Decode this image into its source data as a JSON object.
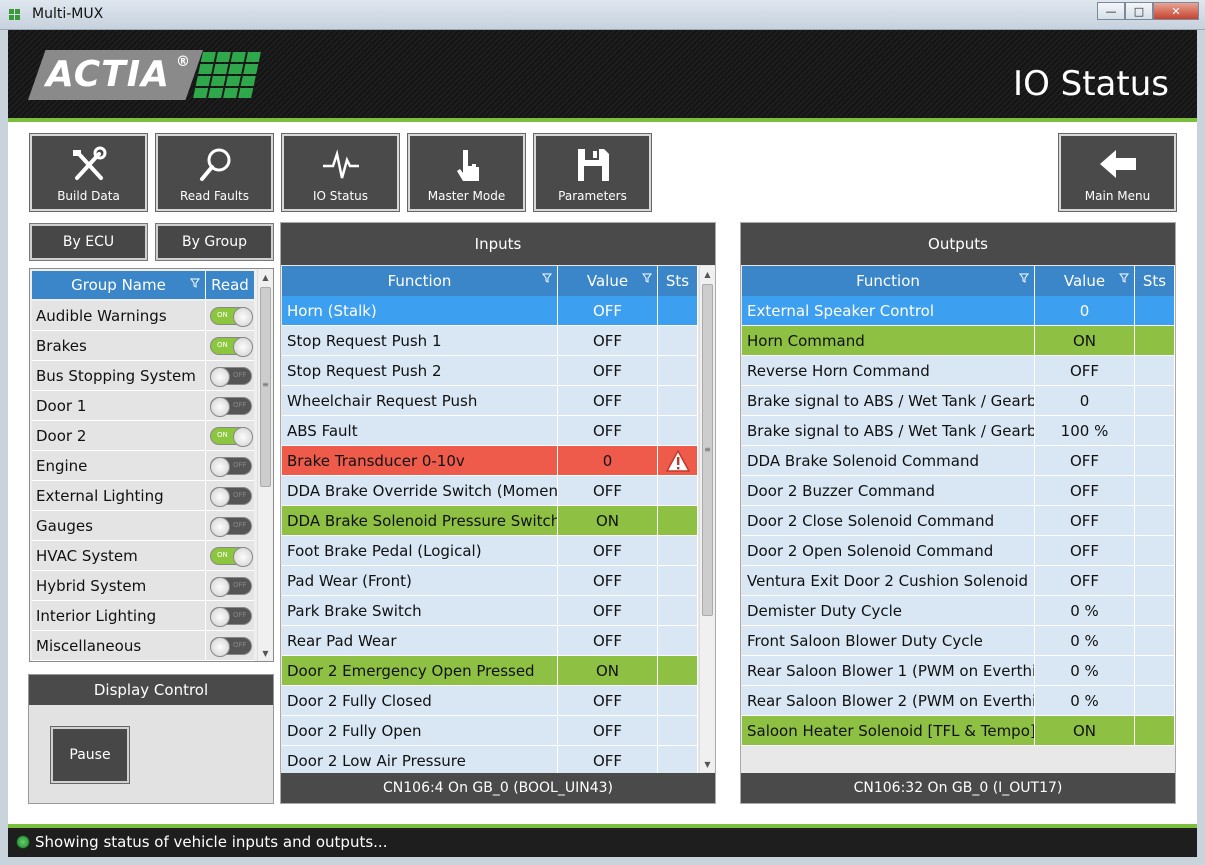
{
  "window": {
    "title": "Multi-MUX"
  },
  "header": {
    "logo_text": "ACTIA",
    "logo_reg": "®",
    "page_title": "IO Status"
  },
  "toolbar": [
    {
      "id": "build-data",
      "label": "Build Data",
      "icon": "tools-icon"
    },
    {
      "id": "read-faults",
      "label": "Read Faults",
      "icon": "magnifier-icon"
    },
    {
      "id": "io-status",
      "label": "IO Status",
      "icon": "pulse-icon"
    },
    {
      "id": "master-mode",
      "label": "Master Mode",
      "icon": "pointer-hand-icon"
    },
    {
      "id": "parameters",
      "label": "Parameters",
      "icon": "floppy-disk-icon"
    }
  ],
  "main_menu": {
    "label": "Main Menu",
    "icon": "arrow-left-icon"
  },
  "tabs": {
    "by_ecu": "By ECU",
    "by_group": "By Group"
  },
  "groups": {
    "col_name": "Group Name",
    "col_read": "Read",
    "rows": [
      {
        "name": "Audible Warnings",
        "read": true
      },
      {
        "name": "Brakes",
        "read": true
      },
      {
        "name": "Bus Stopping System",
        "read": false
      },
      {
        "name": "Door 1",
        "read": false
      },
      {
        "name": "Door 2",
        "read": true
      },
      {
        "name": "Engine",
        "read": false
      },
      {
        "name": "External Lighting",
        "read": false
      },
      {
        "name": "Gauges",
        "read": false
      },
      {
        "name": "HVAC System",
        "read": true
      },
      {
        "name": "Hybrid System",
        "read": false
      },
      {
        "name": "Interior Lighting",
        "read": false
      },
      {
        "name": "Miscellaneous",
        "read": false
      }
    ],
    "toggle_on": "ON",
    "toggle_off": "OFF"
  },
  "display_control": {
    "title": "Display Control",
    "pause_label": "Pause"
  },
  "inputs": {
    "title": "Inputs",
    "columns": [
      "Function",
      "Value",
      "Sts"
    ],
    "footer": "CN106:4 On GB_0 (BOOL_UIN43)",
    "rows": [
      {
        "fn": "Horn (Stalk)",
        "value": "OFF",
        "state": "sel"
      },
      {
        "fn": "Stop Request Push 1",
        "value": "OFF",
        "state": ""
      },
      {
        "fn": "Stop Request Push 2",
        "value": "OFF",
        "state": ""
      },
      {
        "fn": "Wheelchair Request Push",
        "value": "OFF",
        "state": ""
      },
      {
        "fn": "ABS Fault",
        "value": "OFF",
        "state": ""
      },
      {
        "fn": "Brake Transducer 0-10v",
        "value": "0",
        "state": "err"
      },
      {
        "fn": "DDA Brake Override Switch (Momen…",
        "value": "OFF",
        "state": ""
      },
      {
        "fn": "DDA Brake Solenoid Pressure Switch…",
        "value": "ON",
        "state": "on"
      },
      {
        "fn": "Foot Brake Pedal (Logical)",
        "value": "OFF",
        "state": ""
      },
      {
        "fn": "Pad Wear (Front)",
        "value": "OFF",
        "state": ""
      },
      {
        "fn": "Park Brake Switch",
        "value": "OFF",
        "state": ""
      },
      {
        "fn": "Rear Pad Wear",
        "value": "OFF",
        "state": ""
      },
      {
        "fn": "Door 2 Emergency Open Pressed",
        "value": "ON",
        "state": "on"
      },
      {
        "fn": "Door 2 Fully Closed",
        "value": "OFF",
        "state": ""
      },
      {
        "fn": "Door 2 Fully Open",
        "value": "OFF",
        "state": ""
      },
      {
        "fn": "Door 2 Low Air Pressure",
        "value": "OFF",
        "state": ""
      }
    ]
  },
  "outputs": {
    "title": "Outputs",
    "columns": [
      "Function",
      "Value",
      "Sts"
    ],
    "footer": "CN106:32 On GB_0 (I_OUT17)",
    "rows": [
      {
        "fn": "External Speaker Control",
        "value": "0",
        "state": "sel"
      },
      {
        "fn": "Horn Command",
        "value": "ON",
        "state": "on"
      },
      {
        "fn": "Reverse Horn Command",
        "value": "OFF",
        "state": ""
      },
      {
        "fn": "Brake signal to ABS / Wet Tank / Gearb…",
        "value": "0",
        "state": ""
      },
      {
        "fn": "Brake signal to ABS / Wet Tank / Gearb…",
        "value": "100 %",
        "state": ""
      },
      {
        "fn": "DDA Brake Solenoid Command",
        "value": "OFF",
        "state": ""
      },
      {
        "fn": "Door 2 Buzzer Command",
        "value": "OFF",
        "state": ""
      },
      {
        "fn": "Door 2 Close Solenoid Command",
        "value": "OFF",
        "state": ""
      },
      {
        "fn": "Door 2 Open Solenoid Command",
        "value": "OFF",
        "state": ""
      },
      {
        "fn": "Ventura Exit Door 2 Cushion Solenoid …",
        "value": "OFF",
        "state": ""
      },
      {
        "fn": "Demister Duty Cycle",
        "value": "0 %",
        "state": ""
      },
      {
        "fn": "Front Saloon Blower Duty Cycle",
        "value": "0 %",
        "state": ""
      },
      {
        "fn": "Rear Saloon Blower 1 (PWM on Everthi…",
        "value": "0 %",
        "state": ""
      },
      {
        "fn": "Rear Saloon Blower 2 (PWM on Everthi…",
        "value": "0 %",
        "state": ""
      },
      {
        "fn": "Saloon Heater Solenoid [TFL & Tempo]…",
        "value": "ON",
        "state": "on"
      }
    ]
  },
  "status_bar": {
    "text": "Showing status of vehicle inputs and outputs...",
    "indicator_color": "#2ea84a"
  },
  "colors": {
    "accent_blue": "#3a86c8",
    "selected_blue": "#3d9ff0",
    "on_green": "#8dc043",
    "error_red": "#ee5b4b",
    "header_green": "#7bbf3c"
  }
}
